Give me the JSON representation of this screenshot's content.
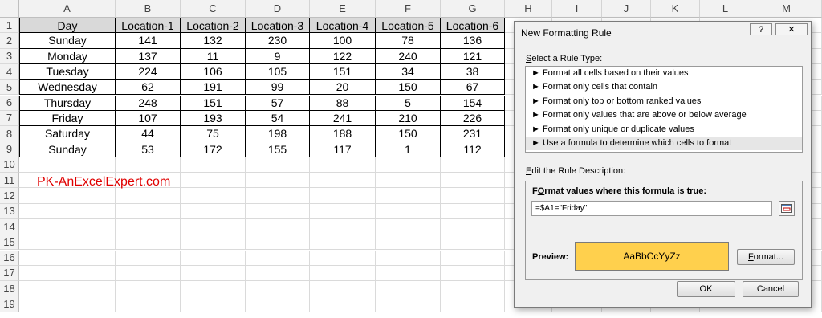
{
  "sheet": {
    "columns": [
      "A",
      "B",
      "C",
      "D",
      "E",
      "F",
      "G",
      "H",
      "I",
      "J",
      "K",
      "L",
      "M"
    ],
    "rows": [
      "1",
      "2",
      "3",
      "4",
      "5",
      "6",
      "7",
      "8",
      "9",
      "10",
      "11",
      "12",
      "13",
      "14",
      "15",
      "16",
      "17",
      "18",
      "19"
    ],
    "table": {
      "headers": [
        "Day",
        "Location-1",
        "Location-2",
        "Location-3",
        "Location-4",
        "Location-5",
        "Location-6"
      ],
      "data": [
        [
          "Sunday",
          "141",
          "132",
          "230",
          "100",
          "78",
          "136"
        ],
        [
          "Monday",
          "137",
          "11",
          "9",
          "122",
          "240",
          "121"
        ],
        [
          "Tuesday",
          "224",
          "106",
          "105",
          "151",
          "34",
          "38"
        ],
        [
          "Wednesday",
          "62",
          "191",
          "99",
          "20",
          "150",
          "67"
        ],
        [
          "Thursday",
          "248",
          "151",
          "57",
          "88",
          "5",
          "154"
        ],
        [
          "Friday",
          "107",
          "193",
          "54",
          "241",
          "210",
          "226"
        ],
        [
          "Saturday",
          "44",
          "75",
          "198",
          "188",
          "150",
          "231"
        ],
        [
          "Sunday",
          "53",
          "172",
          "155",
          "117",
          "1",
          "112"
        ]
      ]
    },
    "watermark": "PK-AnExcelExpert.com"
  },
  "dialog": {
    "title": "New Formatting Rule",
    "help_label": "?",
    "close_label": "✕",
    "rule_type_label": {
      "accel": "S",
      "rest": "elect a Rule Type:"
    },
    "rule_types": [
      "► Format all cells based on their values",
      "► Format only cells that contain",
      "► Format only top or bottom ranked values",
      "► Format only values that are above or below average",
      "► Format only unique or duplicate values",
      "► Use a formula to determine which cells to format"
    ],
    "selected_rule_index": 5,
    "description_label": {
      "accel": "E",
      "rest": "dit the Rule Description:"
    },
    "formula_label": {
      "accel": "O",
      "pre": "F",
      "rest": "rmat values where this formula is true:"
    },
    "formula_value": "=$A1=\"Friday\"",
    "preview_label": "Preview:",
    "preview_text": "AaBbCcYyZz",
    "preview_color": "#ffd04d",
    "format_button": {
      "accel": "F",
      "rest": "ormat..."
    },
    "ok_label": "OK",
    "cancel_label": "Cancel"
  }
}
